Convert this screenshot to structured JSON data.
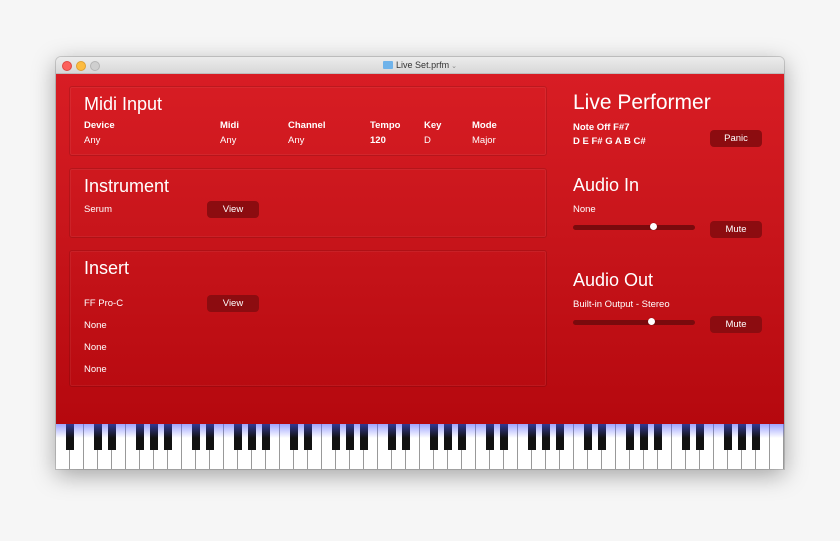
{
  "window": {
    "title": "Live Set.prfm"
  },
  "midi_input": {
    "title": "Midi Input",
    "columns": [
      {
        "label": "Device",
        "value": "Any"
      },
      {
        "label": "Midi",
        "value": "Any"
      },
      {
        "label": "Channel",
        "value": "Any"
      },
      {
        "label": "Tempo",
        "value": "120"
      },
      {
        "label": "Key",
        "value": "D"
      },
      {
        "label": "Mode",
        "value": "Major"
      }
    ]
  },
  "instrument": {
    "title": "Instrument",
    "name": "Serum",
    "view_label": "View"
  },
  "insert": {
    "title": "Insert",
    "slots": [
      "FF Pro-C",
      "None",
      "None",
      "None"
    ],
    "view_label": "View"
  },
  "live_performer": {
    "title": "Live Performer",
    "note_status": "Note Off F#7",
    "scale_notes": "D E F# G A B C#",
    "panic_label": "Panic"
  },
  "audio_in": {
    "title": "Audio In",
    "device": "None",
    "mute_label": "Mute",
    "level": 0.66
  },
  "audio_out": {
    "title": "Audio Out",
    "device": "Built-in Output - Stereo",
    "mute_label": "Mute",
    "level": 0.64
  },
  "colors": {
    "accent": "#d81d24",
    "button": "#8c0c10",
    "key_highlight": "#5a64ff"
  }
}
